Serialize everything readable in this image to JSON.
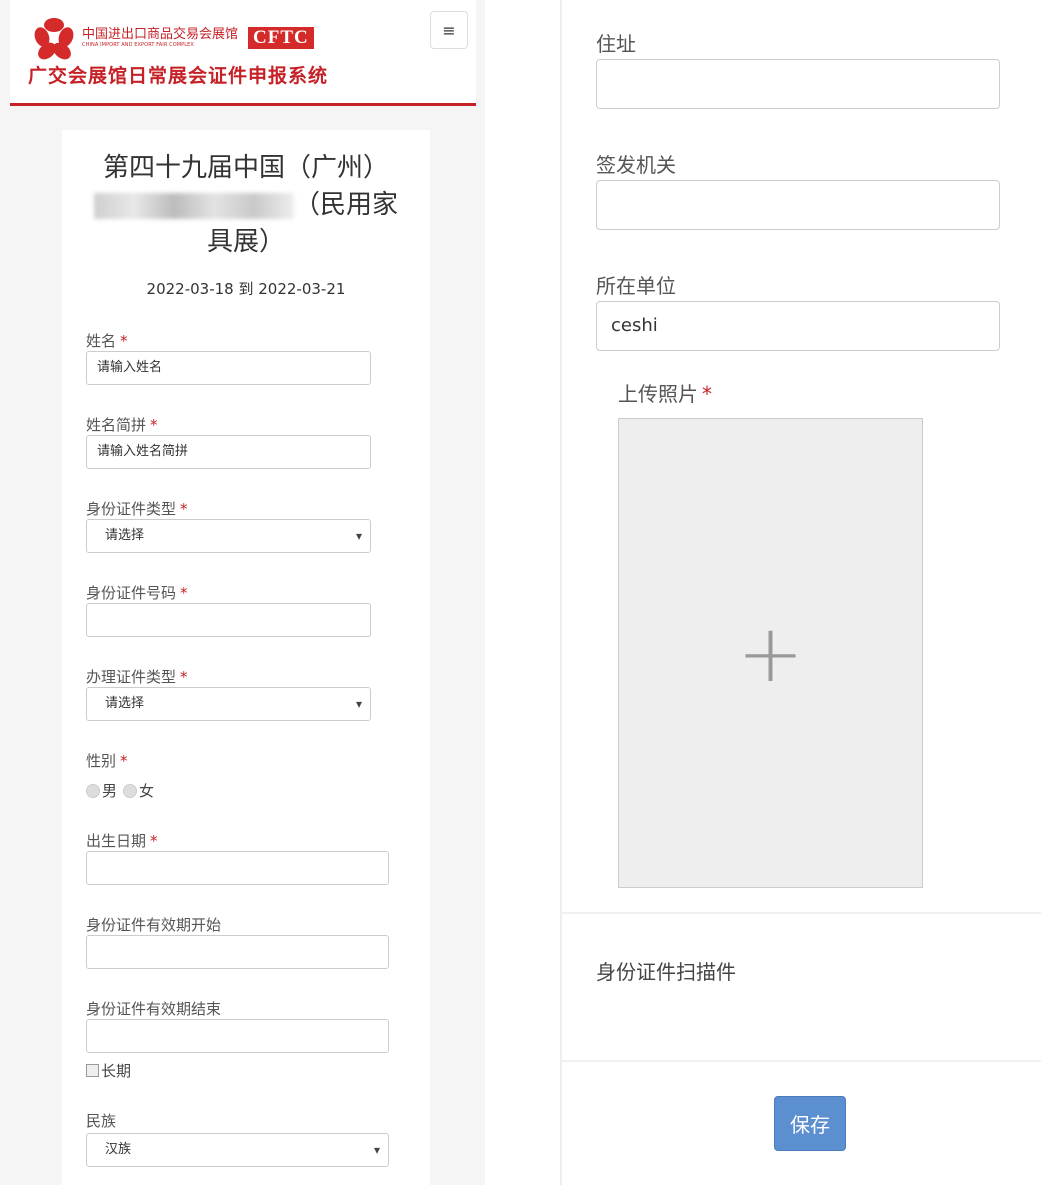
{
  "header": {
    "logo_cn": "中国进出口商品交易会展馆",
    "logo_en": "CHINA IMPORT AND EXPORT FAIR COMPLEX",
    "logo_badge": "CFTC",
    "system_title": "广交会展馆日常展会证件申报系统",
    "menu_icon": "≡"
  },
  "event": {
    "title_line1": "第四十九届中国（广州）",
    "title_line2_suffix": "（民用家",
    "title_line3": "具展）",
    "date_range": "2022-03-18 到 2022-03-21"
  },
  "form": {
    "required_mark": "*",
    "name_label": "姓名",
    "name_placeholder": "请输入姓名",
    "pinyin_label": "姓名简拼",
    "pinyin_placeholder": "请输入姓名简拼",
    "id_type_label": "身份证件类型",
    "id_type_value": "请选择",
    "id_number_label": "身份证件号码",
    "cert_type_label": "办理证件类型",
    "cert_type_value": "请选择",
    "gender_label": "性别",
    "gender_male": "男",
    "gender_female": "女",
    "birth_label": "出生日期",
    "valid_start_label": "身份证件有效期开始",
    "valid_end_label": "身份证件有效期结束",
    "long_term_label": "长期",
    "ethnicity_label": "民族",
    "ethnicity_value": "汉族"
  },
  "right": {
    "address_label": "住址",
    "issuer_label": "签发机关",
    "unit_label": "所在单位",
    "unit_value": "ceshi",
    "photo_label": "上传照片",
    "photo_plus": "+",
    "scan_label": "身份证件扫描件",
    "save_label": "保存"
  }
}
